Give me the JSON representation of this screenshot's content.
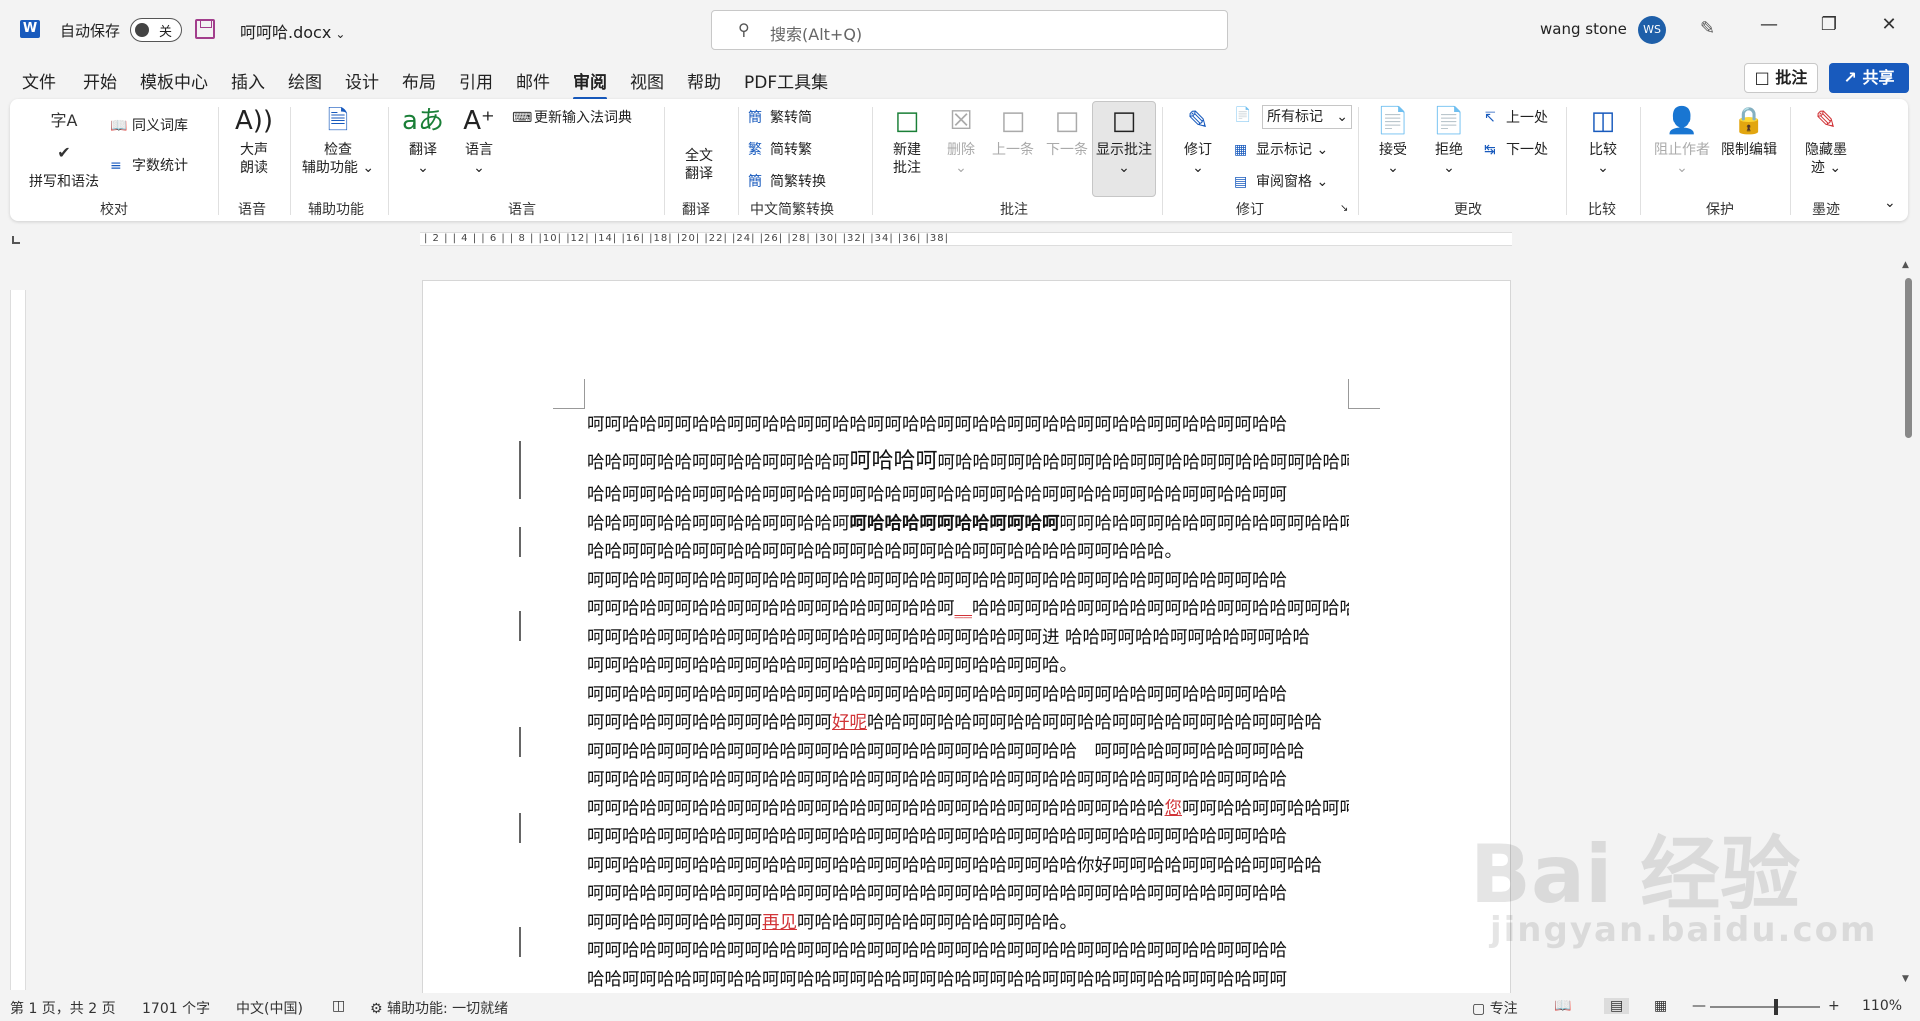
{
  "titlebar": {
    "app_logo": "W",
    "autosave_label": "自动保存",
    "autosave_state": "关",
    "doc_title": "呵呵哈.docx",
    "search_placeholder": "搜索(Alt+Q)",
    "user_name": "wang stone",
    "avatar_initials": "WS"
  },
  "menu": {
    "tabs": [
      "文件",
      "开始",
      "模板中心",
      "插入",
      "绘图",
      "设计",
      "布局",
      "引用",
      "邮件",
      "审阅",
      "视图",
      "帮助",
      "PDF工具集"
    ],
    "active_tab": "审阅",
    "comment_button": "批注",
    "share_button": "共享"
  },
  "ribbon": {
    "proofing": {
      "group": "校对",
      "spelling": "拼写和语法",
      "thesaurus": "同义词库",
      "wordcount": "字数统计"
    },
    "speech": {
      "group": "语音",
      "read_aloud_1": "大声",
      "read_aloud_2": "朗读"
    },
    "accessibility": {
      "group": "辅助功能",
      "check_1": "检查",
      "check_2": "辅助功能"
    },
    "language": {
      "group": "语言",
      "translate": "翻译",
      "language": "语言",
      "update_ime": "更新输入法词典"
    },
    "translation": {
      "group": "翻译",
      "full_1": "全文",
      "full_2": "翻译"
    },
    "chinese_conv": {
      "group": "中文简繁转换",
      "t2s": "繁转简",
      "s2t": "简转繁",
      "conv": "简繁转换"
    },
    "comments": {
      "group": "批注",
      "new_1": "新建",
      "new_2": "批注",
      "delete": "删除",
      "prev": "上一条",
      "next": "下一条",
      "show": "显示批注"
    },
    "tracking": {
      "group": "修订",
      "track": "修订",
      "markup_select": "所有标记",
      "show_markup": "显示标记",
      "pane": "审阅窗格"
    },
    "changes": {
      "group": "更改",
      "accept": "接受",
      "reject": "拒绝",
      "prev": "上一处",
      "next": "下一处"
    },
    "compare": {
      "group": "比较",
      "compare": "比较"
    },
    "protect": {
      "group": "保护",
      "block": "阻止作者",
      "restrict": "限制编辑"
    },
    "ink": {
      "group": "墨迹",
      "hide_1": "隐藏墨",
      "hide_2": "迹"
    }
  },
  "ruler": {
    "ticks": "| 2 |   | 4 |   | 6 |   | 8 |   |10|   |12|   |14|   |16|   |18|   |20|   |22|   |24|   |26|   |28|   |30|   |32|   |34|   |36|   |38|"
  },
  "document": {
    "lines": [
      {
        "t": "呵呵哈哈呵呵哈哈呵呵哈哈呵呵哈哈呵呵哈哈呵呵哈哈呵呵哈哈呵呵哈哈呵呵哈哈呵呵哈哈"
      },
      {
        "a": "哈哈呵呵哈哈呵呵哈哈呵呵哈哈呵",
        "big": "呵哈哈呵",
        "b": "呵哈哈呵呵哈哈呵呵哈哈呵呵哈哈呵呵哈哈呵呵哈哈呵呵"
      },
      {
        "t": "哈哈呵呵哈哈呵呵哈哈呵呵哈哈呵呵哈哈呵呵哈哈呵呵哈哈呵呵哈哈呵呵哈哈呵呵哈哈呵呵"
      },
      {
        "a": "哈哈呵呵哈哈呵呵哈哈呵呵哈哈呵",
        "bold": "呵哈哈哈呵呵哈哈呵呵哈呵",
        "b": "呵呵哈哈呵呵哈哈呵呵哈哈呵呵哈哈呵呵"
      },
      {
        "t": "哈哈呵呵哈哈呵呵哈哈呵呵哈哈呵呵哈哈呵呵哈哈呵呵哈哈哈哈呵呵哈哈哈。"
      },
      {
        "t": "呵呵哈哈呵呵哈哈呵呵哈哈呵呵哈哈呵呵哈哈呵呵哈哈呵呵哈哈呵呵哈哈呵呵哈哈呵呵哈哈"
      },
      {
        "a": "呵呵哈哈呵呵哈哈呵呵哈哈呵呵哈哈呵呵哈哈呵",
        "ins": "__",
        "b": "哈哈呵呵哈哈呵呵哈哈呵呵哈哈呵呵哈哈呵呵哈哈"
      },
      {
        "t": "呵呵哈哈呵呵哈哈呵呵哈哈呵呵哈哈呵呵哈哈呵呵哈哈呵呵进 哈哈呵呵哈哈呵呵哈哈呵呵哈哈"
      },
      {
        "t": "呵呵哈哈呵呵哈哈呵呵哈哈呵呵哈哈呵呵哈哈呵呵哈哈呵呵哈。"
      },
      {
        "t": "呵呵哈哈呵呵哈哈呵呵哈哈呵呵哈哈呵呵哈哈呵呵哈哈呵呵哈哈呵呵哈哈呵呵哈哈呵呵哈哈"
      },
      {
        "a": "呵呵哈哈呵呵哈哈呵呵哈哈呵呵",
        "ins": "好呢",
        "b": "哈哈呵呵哈哈呵呵哈哈呵呵哈哈呵呵哈哈呵呵哈哈呵呵哈哈"
      },
      {
        "t": "呵呵哈哈呵呵哈哈呵呵哈哈呵呵哈哈呵呵哈哈呵呵哈哈呵呵哈哈　呵呵哈哈呵呵哈哈呵呵哈哈"
      },
      {
        "t": "呵呵哈哈呵呵哈哈呵呵哈哈呵呵哈哈呵呵哈哈呵呵哈哈呵呵哈哈呵呵哈哈呵呵哈哈呵呵哈哈"
      },
      {
        "a": "呵呵哈哈呵呵哈哈呵呵哈哈呵呵哈哈呵呵哈哈呵呵哈哈呵呵哈哈呵呵哈哈哈",
        "ins": "您",
        "b": "呵呵哈哈呵呵哈哈呵呵哈哈"
      },
      {
        "t": "呵呵哈哈呵呵哈哈呵呵哈哈呵呵哈哈呵呵哈哈呵呵哈哈呵呵哈哈呵呵哈哈呵呵哈哈呵呵哈哈"
      },
      {
        "t": "呵呵哈哈呵呵哈哈呵呵哈哈呵呵哈哈呵呵哈哈呵呵哈哈呵呵哈哈你好呵呵哈哈呵呵哈哈呵呵哈哈"
      },
      {
        "t": "呵呵哈哈呵呵哈哈呵呵哈哈呵呵哈哈呵呵哈哈呵呵哈哈呵呵哈哈呵呵哈哈呵呵哈哈呵呵哈哈"
      },
      {
        "a": "呵呵哈哈呵呵哈哈呵呵",
        "ins": "再见",
        "b": "呵哈哈呵呵哈哈呵呵哈哈呵呵哈哈。"
      },
      {
        "t": "呵呵哈哈呵呵哈哈呵呵哈哈呵呵哈哈呵呵哈哈呵呵哈哈呵呵哈哈呵呵哈哈呵呵哈哈呵呵哈哈"
      },
      {
        "t": "哈哈呵呵哈哈呵呵哈哈呵呵哈哈呵呵哈哈呵呵哈哈呵呵哈哈呵呵哈哈呵呵哈哈呵呵哈哈呵呵"
      }
    ]
  },
  "statusbar": {
    "page": "第 1 页，共 2 页",
    "words": "1701 个字",
    "language": "中文(中国)",
    "accessibility": "辅助功能: 一切就绪",
    "focus": "专注",
    "zoom": "110%"
  },
  "watermark": {
    "logo": "Bai 经验",
    "url": "jingyan.baidu.com"
  },
  "colors": {
    "accent": "#185abd",
    "insertion": "#d13438",
    "ribbon_bg": "#ffffff",
    "chrome_bg": "#f3f3f3"
  },
  "icons": [
    "word-logo-icon",
    "save-icon",
    "search-icon",
    "pen-icon",
    "minimize-icon",
    "restore-icon",
    "close-icon",
    "comment-icon",
    "share-icon"
  ]
}
